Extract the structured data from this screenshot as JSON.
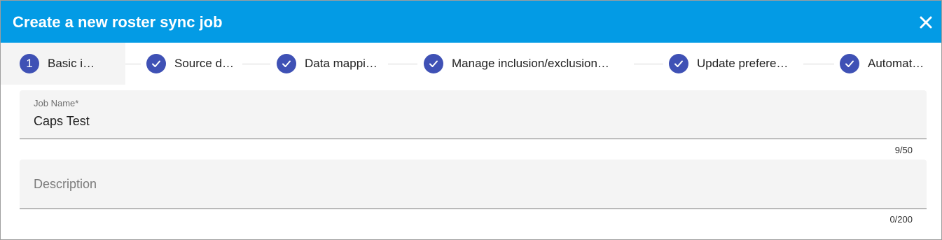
{
  "dialog": {
    "title": "Create a new roster sync job",
    "close_icon": "close-icon"
  },
  "stepper": {
    "steps": [
      {
        "indicator": "1",
        "label": "Basic i…",
        "state": "active"
      },
      {
        "indicator": "check-icon",
        "label": "Source d…",
        "state": "completed"
      },
      {
        "indicator": "check-icon",
        "label": "Data mappi…",
        "state": "completed"
      },
      {
        "indicator": "check-icon",
        "label": "Manage inclusion/exclusion…",
        "state": "completed"
      },
      {
        "indicator": "check-icon",
        "label": "Update prefere…",
        "state": "completed"
      },
      {
        "indicator": "check-icon",
        "label": "Automat…",
        "state": "completed"
      }
    ]
  },
  "form": {
    "job_name": {
      "label": "Job Name*",
      "value": "Caps Test",
      "counter": "9/50"
    },
    "description": {
      "placeholder": "Description",
      "value": "",
      "counter": "0/200"
    }
  },
  "colors": {
    "header": "#039be5",
    "step_indicator": "#3f51b5",
    "field_background": "#f4f4f4"
  }
}
